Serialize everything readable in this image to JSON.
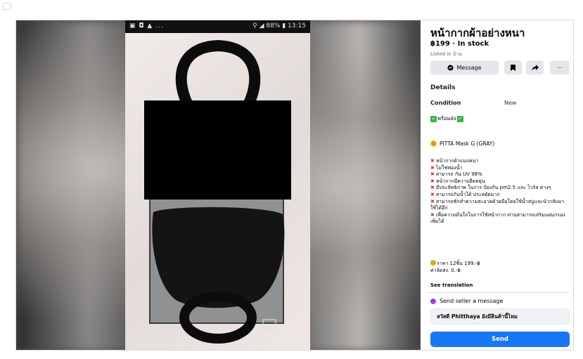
{
  "phone_status": {
    "left": "▣ ◘ ▲ ...",
    "right": "⚲ ◢ 88% ▮ 13:15"
  },
  "listing": {
    "title": "หน้ากากผ้าอย่างหนา",
    "price_status": "฿199 · In stock",
    "listed_in": "Listed in บ้าน",
    "actions": {
      "message_label": "Message",
      "save_icon": "bookmark-icon",
      "share_icon": "share-icon",
      "more_label": "···"
    },
    "details_heading": "Details",
    "condition_label": "Condition",
    "condition_value": "New",
    "ready_text": "พร้อมส่ง",
    "product_name": "PITTA  Mask G (GRAY)",
    "features": [
      "หน้ากากผ้าแบบหนา",
      "ไม่ใช่ฟองน้ำ",
      "สามารถ กัน UV 98%",
      "หน้ากากมีความยืดหยุ่น",
      "มีประสิทธิภาพ ในการ ป้องกัน pm2.5 และ ไวรัส ต่างๆ",
      "สามารถกันน้ำได้ ประหยัดมาก",
      "สามารถซักทำความสะอาดด้วยมือโดยใช้น้ำสบู่และนำกลับมาใช้ได้อีก",
      "เพื่อความมั่นใจในการใช้หน้ากาก ท่านสามารถเสริมแผ่นกรองเพิ่มได้"
    ],
    "price_line": "ราคา 12ชิ้น  199.-฿",
    "shipping_line": "ค่าจัดส่ง. 0.-฿",
    "see_translation": "See translation"
  },
  "contact": {
    "heading": "Send seller a message",
    "message_value": "สวัสดี Phitthaya ยังมีสินค้านี้ไหม",
    "send_label": "Send"
  },
  "colors": {
    "accent": "#1877f2",
    "button_bg": "#e4e6eb",
    "redaction": "#000000",
    "check_green": "#3bb34a"
  }
}
